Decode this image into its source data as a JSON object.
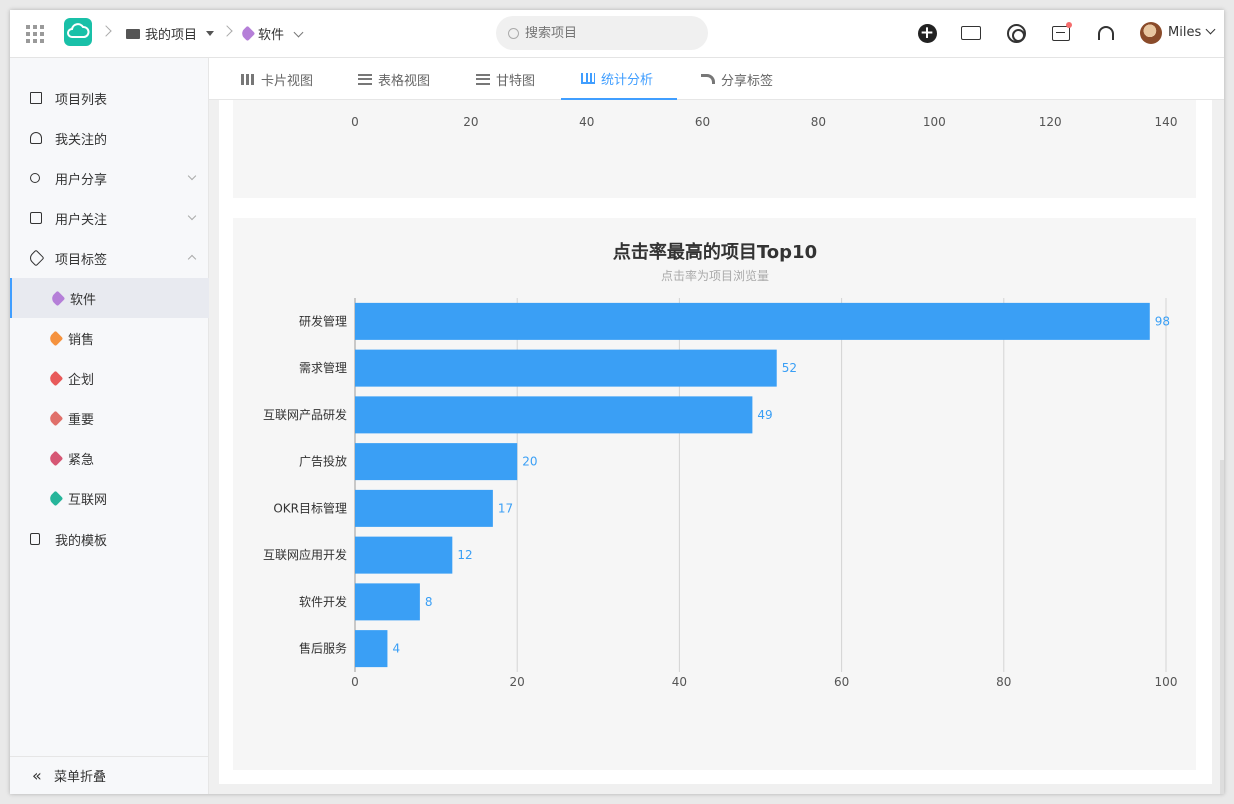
{
  "topbar": {
    "breadcrumb": [
      {
        "label": "我的项目"
      },
      {
        "label": "软件"
      }
    ],
    "search_placeholder": "搜索项目",
    "user_name": "Miles",
    "tag_color": "#b57fd8"
  },
  "sidebar": {
    "items": [
      {
        "label": "项目列表",
        "icon": "folder-icon"
      },
      {
        "label": "我关注的",
        "icon": "heart-icon"
      },
      {
        "label": "用户分享",
        "icon": "share-icon"
      },
      {
        "label": "用户关注",
        "icon": "follow-icon"
      },
      {
        "label": "项目标签",
        "icon": "tag-icon"
      }
    ],
    "tags": [
      {
        "label": "软件",
        "color": "#b57fd8"
      },
      {
        "label": "销售",
        "color": "#f5923e"
      },
      {
        "label": "企划",
        "color": "#e85a5a"
      },
      {
        "label": "重要",
        "color": "#e0706a"
      },
      {
        "label": "紧急",
        "color": "#d65774"
      },
      {
        "label": "互联网",
        "color": "#26b59a"
      }
    ],
    "templates": {
      "label": "我的模板",
      "icon": "template-icon"
    },
    "collapse_label": "菜单折叠"
  },
  "tabs": [
    {
      "label": "卡片视图",
      "icon": "grid-icon"
    },
    {
      "label": "表格视图",
      "icon": "list-icon"
    },
    {
      "label": "甘特图",
      "icon": "gantt-icon"
    },
    {
      "label": "统计分析",
      "icon": "bar-chart-icon",
      "active": true
    },
    {
      "label": "分享标签",
      "icon": "share-arrow-icon"
    }
  ],
  "chart_data": [
    {
      "type": "bar",
      "note_visible": "bottom axis of a chart scrolled out of view",
      "xticks": [
        "0",
        "20",
        "40",
        "60",
        "80",
        "100",
        "120",
        "140"
      ],
      "xlim": [
        0,
        140
      ]
    },
    {
      "type": "bar",
      "orientation": "horizontal",
      "title": "点击率最高的项目Top10",
      "subtitle": "点击率为项目浏览量",
      "categories": [
        "研发管理",
        "需求管理",
        "互联网产品研发",
        "广告投放",
        "OKR目标管理",
        "互联网应用开发",
        "软件开发",
        "售后服务"
      ],
      "values": [
        98,
        52,
        49,
        20,
        17,
        12,
        8,
        4
      ],
      "xticks": [
        "0",
        "20",
        "40",
        "60",
        "80",
        "100"
      ],
      "xlim": [
        0,
        100
      ],
      "bar_color": "#3a9ff5",
      "label_color": "#3a9ff5",
      "grid": true
    }
  ]
}
